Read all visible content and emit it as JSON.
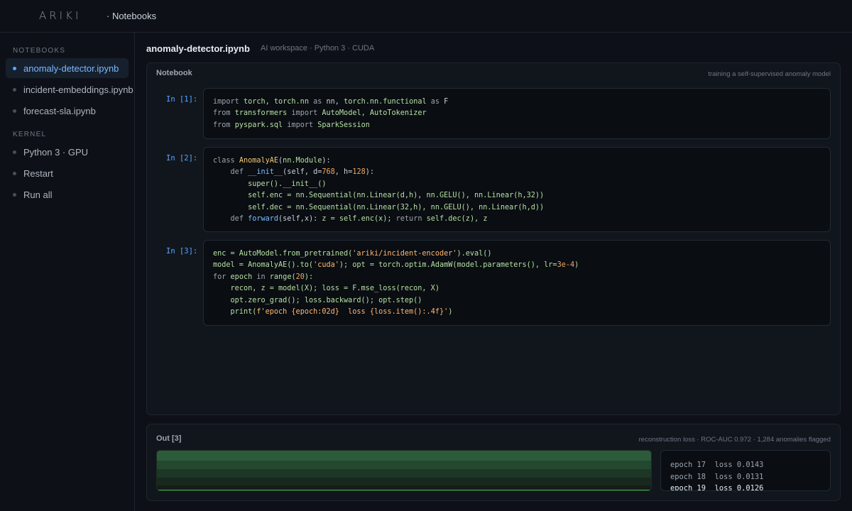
{
  "app": {
    "logo": "ARIKI",
    "breadcrumb": "· Notebooks"
  },
  "sidebar": {
    "notebooks_heading": "NOTEBOOKS",
    "notebooks": [
      {
        "label": "anomaly-detector.ipynb",
        "active": true
      },
      {
        "label": "incident-embeddings.ipynb",
        "active": false
      },
      {
        "label": "forecast-sla.ipynb",
        "active": false
      }
    ],
    "kernel_heading": "KERNEL",
    "kernel_items": [
      {
        "label": "Python 3 · GPU"
      },
      {
        "label": "Restart"
      },
      {
        "label": "Run all"
      }
    ]
  },
  "header": {
    "title": "anomaly-detector.ipynb",
    "subtitle": "AI workspace · Python 3 · CUDA"
  },
  "notebook_panel": {
    "title": "Notebook",
    "note": "training a self-supervised anomaly model",
    "cells": [
      {
        "label": "In [1]:",
        "code": [
          "import torch, torch.nn as nn, torch.nn.functional as F",
          "from transformers import AutoModel, AutoTokenizer",
          "from pyspark.sql import SparkSession"
        ]
      },
      {
        "label": "In [2]:",
        "code": [
          "class AnomalyAE(nn.Module):",
          "    def __init__(self, d=768, h=128):",
          "        super().__init__()",
          "        self.enc = nn.Sequential(nn.Linear(d,h), nn.GELU(), nn.Linear(h,32))",
          "        self.dec = nn.Sequential(nn.Linear(32,h), nn.GELU(), nn.Linear(h,d))",
          "    def forward(self,x): z = self.enc(x); return self.dec(z), z"
        ]
      },
      {
        "label": "In [3]:",
        "code": [
          "enc = AutoModel.from_pretrained('ariki/incident-encoder').eval()",
          "model = AnomalyAE().to('cuda'); opt = torch.optim.AdamW(model.parameters(), lr=3e-4)",
          "for epoch in range(20):",
          "    recon, z = model(X); loss = F.mse_loss(recon, X)",
          "    opt.zero_grad(); loss.backward(); opt.step()",
          "    print(f'epoch {epoch:02d}  loss {loss.item():.4f}')"
        ]
      }
    ]
  },
  "output_panel": {
    "title": "Out [3]",
    "note": "reconstruction loss · ROC-AUC 0.972 · 1,284 anomalies flagged",
    "log": [
      "epoch 17  loss 0.0143",
      "epoch 18  loss 0.0131",
      "epoch 19  loss 0.0126"
    ],
    "colors": {
      "band_top": "#2a5a3a",
      "band_bottom": "#142019",
      "line": "#3fb950"
    }
  }
}
